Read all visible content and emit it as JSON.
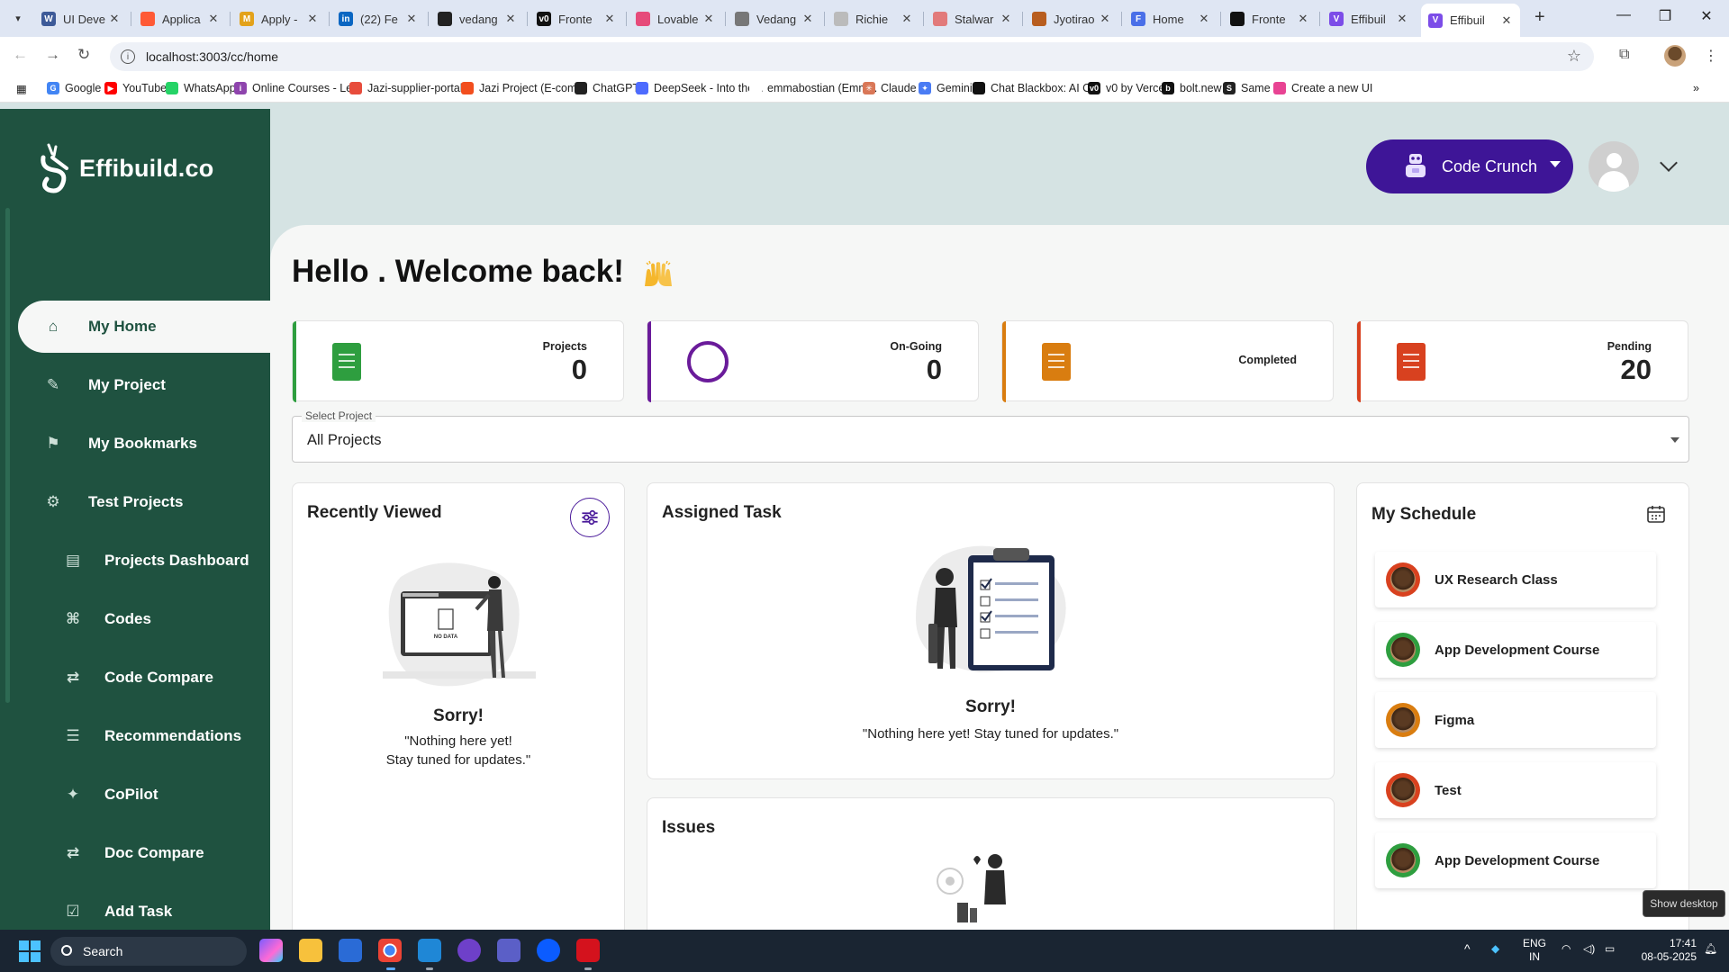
{
  "browser": {
    "tabs": [
      {
        "title": "UI Deve",
        "color": "#3d5a98",
        "letter": "W"
      },
      {
        "title": "Applica",
        "color": "#ff5a36",
        "letter": ""
      },
      {
        "title": "Apply -",
        "color": "#e3a21a",
        "letter": "M"
      },
      {
        "title": "(22) Fe",
        "color": "#0a66c2",
        "letter": "in"
      },
      {
        "title": "vedang",
        "color": "#222222",
        "letter": ""
      },
      {
        "title": "Fronte",
        "color": "#111111",
        "letter": "v0"
      },
      {
        "title": "Lovable",
        "color": "#e64b7a",
        "letter": ""
      },
      {
        "title": "Vedang",
        "color": "#777777",
        "letter": ""
      },
      {
        "title": "Richie",
        "color": "#bbbbbb",
        "letter": ""
      },
      {
        "title": "Stalwar",
        "color": "#e27a7a",
        "letter": ""
      },
      {
        "title": "Jyotirao",
        "color": "#b85d1e",
        "letter": ""
      },
      {
        "title": "Home",
        "color": "#4a6fe8",
        "letter": "F"
      },
      {
        "title": "Fronte",
        "color": "#111111",
        "letter": ""
      },
      {
        "title": "Effibuil",
        "color": "#7c4de8",
        "letter": "V"
      },
      {
        "title": "Effibuil",
        "color": "#7c4de8",
        "letter": "V",
        "active": true
      }
    ],
    "url": "localhost:3003/cc/home",
    "bookmarks": [
      {
        "label": "Google",
        "color": "#4285f4",
        "letter": "G"
      },
      {
        "label": "YouTube",
        "color": "#ff0000",
        "letter": "▶"
      },
      {
        "label": "WhatsApp",
        "color": "#25d366",
        "letter": ""
      },
      {
        "label": "Online Courses - Le...",
        "color": "#8e44ad",
        "letter": "i"
      },
      {
        "label": "Jazi-supplier-portal...",
        "color": "#e74c3c",
        "letter": ""
      },
      {
        "label": "Jazi Project (E-com...",
        "color": "#f24e1e",
        "letter": ""
      },
      {
        "label": "ChatGPT",
        "color": "#222222",
        "letter": ""
      },
      {
        "label": "DeepSeek - Into the...",
        "color": "#4d6bfe",
        "letter": ""
      },
      {
        "label": "emmabostian (Emm...",
        "color": "#ffffff",
        "letter": ""
      },
      {
        "label": "Claude",
        "color": "#d97757",
        "letter": "✳"
      },
      {
        "label": "Gemini",
        "color": "#4a7cf4",
        "letter": "✦"
      },
      {
        "label": "Chat Blackbox: AI C...",
        "color": "#111111",
        "letter": ""
      },
      {
        "label": "v0 by Vercel",
        "color": "#111111",
        "letter": "v0"
      },
      {
        "label": "bolt.new",
        "color": "#111111",
        "letter": "b"
      },
      {
        "label": "Same",
        "color": "#222222",
        "letter": "S"
      },
      {
        "label": "Create a new UI",
        "color": "#e84393",
        "letter": ""
      }
    ]
  },
  "app": {
    "brand": "Effibuild.co",
    "sidebar": [
      {
        "label": "My Home",
        "icon": "home-icon",
        "active": true
      },
      {
        "label": "My Project",
        "icon": "project-icon"
      },
      {
        "label": "My Bookmarks",
        "icon": "bookmark-icon"
      },
      {
        "label": "Test Projects",
        "icon": "test-projects-icon"
      },
      {
        "label": "Projects Dashboard",
        "icon": "dashboard-icon",
        "sub": true
      },
      {
        "label": "Codes",
        "icon": "codes-icon",
        "sub": true
      },
      {
        "label": "Code Compare",
        "icon": "compare-icon",
        "sub": true
      },
      {
        "label": "Recommendations",
        "icon": "recommendations-icon",
        "sub": true
      },
      {
        "label": "CoPilot",
        "icon": "copilot-icon",
        "sub": true
      },
      {
        "label": "Doc Compare",
        "icon": "doc-compare-icon",
        "sub": true
      },
      {
        "label": "Add Task",
        "icon": "add-task-icon",
        "sub": true
      }
    ],
    "team_button": "Code Crunch",
    "greeting": "Hello . Welcome back!",
    "stats": [
      {
        "label": "Projects",
        "value": "0",
        "color": "#2e9e3f"
      },
      {
        "label": "On-Going",
        "value": "0",
        "color": "#6a1b9a"
      },
      {
        "label": "Completed",
        "value": "",
        "color": "#d97d10"
      },
      {
        "label": "Pending",
        "value": "20",
        "color": "#d8411f"
      }
    ],
    "select_project": {
      "label": "Select Project",
      "value": "All Projects"
    },
    "recently_viewed": {
      "title": "Recently Viewed",
      "sorry": "Sorry!",
      "message_line1": "\"Nothing here yet!",
      "message_line2": "Stay tuned for updates.\"",
      "no_data": "NO DATA"
    },
    "assigned_task": {
      "title": "Assigned Task",
      "sorry": "Sorry!",
      "message": "\"Nothing here yet! Stay tuned for updates.\""
    },
    "issues": {
      "title": "Issues"
    },
    "schedule": {
      "title": "My Schedule",
      "items": [
        {
          "title": "UX Research Class",
          "ring": "#d8411f"
        },
        {
          "title": "App Development Course",
          "ring": "#2e9e3f"
        },
        {
          "title": "Figma",
          "ring": "#d97d10"
        },
        {
          "title": "Test",
          "ring": "#d8411f"
        },
        {
          "title": "App Development Course",
          "ring": "#2e9e3f"
        }
      ]
    }
  },
  "taskbar": {
    "search": "Search",
    "lang1": "ENG",
    "lang2": "IN",
    "time": "17:41",
    "date": "08-05-2025",
    "show_desktop": "Show desktop"
  }
}
